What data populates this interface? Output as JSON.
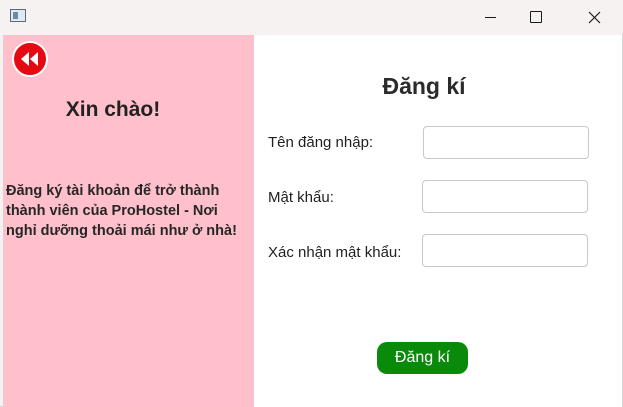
{
  "window": {
    "icons": {
      "app": "app-icon",
      "minimize": "minimize-icon",
      "maximize": "maximize-icon",
      "close": "close-icon"
    }
  },
  "left_panel": {
    "back_icon": "rewind-icon",
    "greeting": "Xin chào!",
    "intro": "Đăng ký tài khoản để trở thành thành viên của ProHostel - Nơi nghỉ dưỡng thoải mái như ở nhà!",
    "background_color": "#ffc0cb"
  },
  "form": {
    "title": "Đăng kí",
    "fields": [
      {
        "label": "Tên đăng nhập:",
        "value": ""
      },
      {
        "label": "Mật khẩu:",
        "value": ""
      },
      {
        "label": "Xác nhận mật khẩu:",
        "value": ""
      }
    ],
    "submit_label": "Đăng kí",
    "submit_color": "#0a8a0a"
  }
}
